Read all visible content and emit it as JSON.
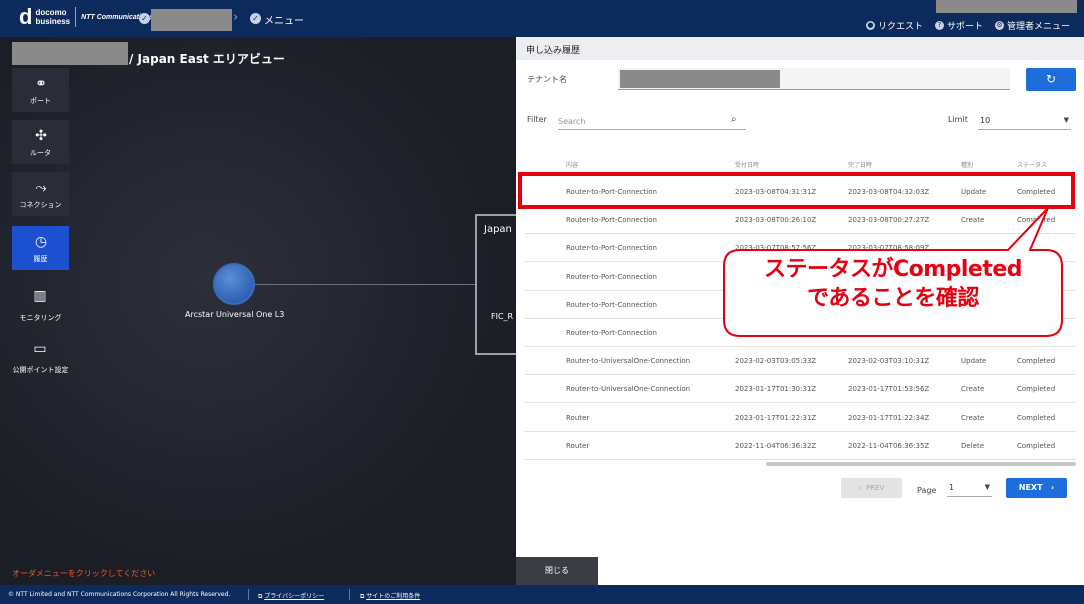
{
  "header": {
    "logo_brand": "d",
    "logo_line1": "docomo",
    "logo_line2": "business",
    "logo_ntt": "NTT Communications",
    "breadcrumb_menu": "メニュー",
    "links": [
      {
        "label": "リクエスト",
        "icon": "person-icon"
      },
      {
        "label": "サポート",
        "icon": "help-icon"
      },
      {
        "label": "管理者メニュー",
        "icon": "gear-icon"
      }
    ]
  },
  "canvas": {
    "area_title": "/ Japan East エリアビュー",
    "sidebar": [
      {
        "label": "ポート",
        "icon": "port-icon"
      },
      {
        "label": "ルータ",
        "icon": "router-icon"
      },
      {
        "label": "コネクション",
        "icon": "connection-icon"
      },
      {
        "label": "履歴",
        "icon": "history-icon",
        "active": true
      },
      {
        "label": "モニタリング",
        "icon": "monitoring-icon"
      },
      {
        "label": "公開ポイント設定",
        "icon": "monitor-icon"
      }
    ],
    "node_label": "Arcstar Universal One L3",
    "region_label": "Japan",
    "fic_label": "FIC_R",
    "order_message": "オーダメニューをクリックしてください"
  },
  "panel": {
    "title": "申し込み履歴",
    "tenant_label": "テナント名",
    "filter_label": "Filter",
    "search_placeholder": "Search",
    "limit_label": "Limit",
    "limit_value": "10",
    "columns": [
      "内容",
      "受付日時",
      "完了日時",
      "種別",
      "ステータス"
    ],
    "rows": [
      [
        "Router-to-Port-Connection",
        "2023-03-08T04:31:31Z",
        "2023-03-08T04:32:03Z",
        "Update",
        "Completed"
      ],
      [
        "Router-to-Port-Connection",
        "2023-03-08T00:26:10Z",
        "2023-03-08T00:27:27Z",
        "Create",
        "Completed"
      ],
      [
        "Router-to-Port-Connection",
        "2023-03-07T08:57:56Z",
        "2023-03-07T08:58:09Z",
        "",
        ""
      ],
      [
        "Router-to-Port-Connection",
        "",
        "",
        "",
        ""
      ],
      [
        "Router-to-Port-Connection",
        "",
        "",
        "",
        ""
      ],
      [
        "Router-to-Port-Connection",
        "",
        "",
        "",
        ""
      ],
      [
        "Router-to-UniversalOne-Connection",
        "2023-02-03T03:05:33Z",
        "2023-02-03T03:10:31Z",
        "Update",
        "Completed"
      ],
      [
        "Router-to-UniversalOne-Connection",
        "2023-01-17T01:30:31Z",
        "2023-01-17T01:53:56Z",
        "Create",
        "Completed"
      ],
      [
        "Router",
        "2023-01-17T01:22:31Z",
        "2023-01-17T01:22:34Z",
        "Create",
        "Completed"
      ],
      [
        "Router",
        "2022-11-04T06:36:32Z",
        "2022-11-04T06:36:35Z",
        "Delete",
        "Completed"
      ]
    ],
    "prev_label": "PREV",
    "page_label": "Page",
    "page_value": "1",
    "next_label": "NEXT",
    "close_label": "閉じる"
  },
  "annotation": {
    "line1": "ステータスがCompleted",
    "line2": "であることを確認",
    "color": "#e60012"
  },
  "footer": {
    "copyright": "© NTT Limited and NTT Communications Corporation All Rights Reserved.",
    "privacy": "プライバシーポリシー",
    "terms": "サイトのご利用条件"
  }
}
